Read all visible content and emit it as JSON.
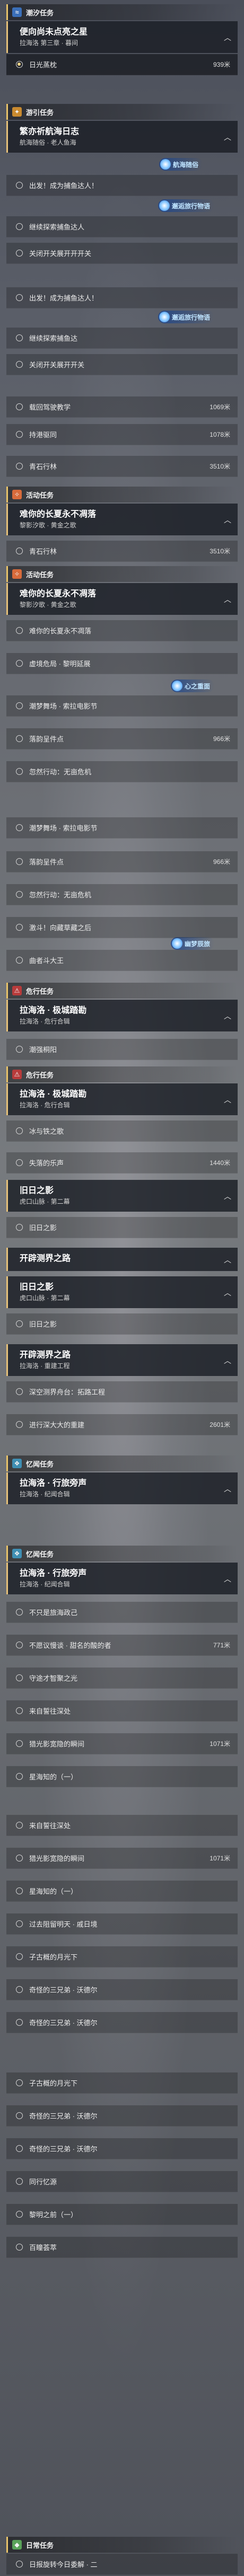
{
  "colors": {
    "accent": "#e8c36a",
    "panel": "#1a1d24",
    "badge": "#bfe4ff"
  },
  "categories": {
    "tide": {
      "label": "潮汐任务",
      "icon": "tide-icon"
    },
    "adventure": {
      "label": "游引任务",
      "icon": "compass-icon"
    },
    "event": {
      "label": "活动任务",
      "icon": "event-icon"
    },
    "danger": {
      "label": "危行任务",
      "icon": "danger-icon"
    },
    "danger_b": {
      "label": "危行任务"
    },
    "memory": {
      "label": "忆闻任务",
      "icon": "memory-icon"
    },
    "memory_b": {
      "label": "忆闻任务"
    },
    "daily": {
      "label": "日常任务",
      "icon": "daily-icon"
    }
  },
  "quests": {
    "q1": {
      "title": "便向尚未点亮之星",
      "sub": "拉海洛 第三章 · 暮间"
    },
    "q2": {
      "title": "繁亦祈航海日志",
      "sub": "航海随俗 · 老人鱼海"
    },
    "q3": {
      "title": "难你的长夏永不凋落",
      "sub": "黎影汐歌 · 黄金之歌"
    },
    "q4": {
      "title": "难你的长夏永不凋落",
      "sub": "黎影汐歌 · 黄金之歌"
    },
    "q5": {
      "title": "拉海洛 · 极城踏勘",
      "sub": "拉海洛 · 危行合辑"
    },
    "q6": {
      "title": "拉海洛 · 极城踏勘",
      "sub": "拉海洛 · 危行合辑"
    },
    "q7": {
      "title": "旧日之影",
      "sub": "虎口山脉 · 第二幕"
    },
    "q8": {
      "title": "开辟测界之路",
      "sub": ""
    },
    "q9": {
      "title": "旧日之影",
      "sub": "虎口山脉 · 第二幕"
    },
    "q10": {
      "title": "开辟测界之路",
      "sub": "拉海洛 · 重建工程"
    },
    "q11": {
      "title": "拉海洛 · 行旅旁声",
      "sub": "拉海洛 · 纪闻合辑"
    },
    "q12": {
      "title": "拉海洛 · 行旅旁声",
      "sub": "拉海洛 · 纪闻合辑"
    }
  },
  "steps": {
    "s1": {
      "label": "日光蒸枕",
      "dist": "939米"
    },
    "s2": {
      "label": "出发！成为捕鱼达人！",
      "dist": ""
    },
    "s3": {
      "label": "继续探索捕鱼达人",
      "dist": ""
    },
    "s4": {
      "label": "关闭开关展开开开关",
      "dist": ""
    },
    "s5": {
      "label": "出发！成为捕鱼达人！",
      "dist": ""
    },
    "s6": {
      "label": "继续探索捕鱼达",
      "dist": ""
    },
    "s7": {
      "label": "关闭开关展开开关",
      "dist": ""
    },
    "s8": {
      "label": "载回驾驶教学",
      "dist": "1069米"
    },
    "s9": {
      "label": "持港驱同",
      "dist": "1078米"
    },
    "s10": {
      "label": "青石行林",
      "dist": "3510米"
    },
    "s11": {
      "label": "青石行林",
      "dist": "3510米"
    },
    "s12": {
      "label": "难你的长夏永不凋落",
      "dist": ""
    },
    "s13": {
      "label": "虚境危局 · 黎明延展",
      "dist": ""
    },
    "s14": {
      "label": "潮梦舞场 · 索拉电影节",
      "dist": ""
    },
    "s15": {
      "label": "落韵呈件点",
      "dist": "966米"
    },
    "s16": {
      "label": "忽然行动：无亩危机",
      "dist": ""
    },
    "s17": {
      "label": "潮梦舞场 · 索拉电影节",
      "dist": ""
    },
    "s18": {
      "label": "落韵呈件点",
      "dist": "966米"
    },
    "s19": {
      "label": "忽然行动：无亩危机",
      "dist": ""
    },
    "s20": {
      "label": "激斗！向藏草藏之后",
      "dist": ""
    },
    "s21": {
      "label": "曲者斗大王",
      "dist": ""
    },
    "s22": {
      "label": "潮强桐阳",
      "dist": ""
    },
    "s23": {
      "label": "冰与铁之歌",
      "dist": ""
    },
    "s24": {
      "label": "失落的乐声",
      "dist": "1440米"
    },
    "s25": {
      "label": "旧日之影",
      "dist": ""
    },
    "s26": {
      "label": "旧日之影",
      "dist": ""
    },
    "s27": {
      "label": "深空测界舟台：拓路工程",
      "dist": ""
    },
    "s28": {
      "label": "进行深大大的重建",
      "dist": "2601米"
    },
    "s29": {
      "label": "不只是旅海政己",
      "dist": ""
    },
    "s30": {
      "label": "不愿议慢谈 · 甜名的酸的者",
      "dist": "771米"
    },
    "s31": {
      "label": "守途才智聚之光",
      "dist": ""
    },
    "s32": {
      "label": "来自誓往深处",
      "dist": ""
    },
    "s33": {
      "label": "猎光影宽隐的瞬间",
      "dist": "1071米"
    },
    "s34": {
      "label": "星海知的（一）",
      "dist": ""
    },
    "s35": {
      "label": "来自誓往深处",
      "dist": ""
    },
    "s36": {
      "label": "猎光影宽隐的瞬间",
      "dist": "1071米"
    },
    "s37": {
      "label": "星海知的（一）",
      "dist": ""
    },
    "s38": {
      "label": "过去阻留明天 · 戚日境",
      "dist": ""
    },
    "s39": {
      "label": "子古概的月光下",
      "dist": ""
    },
    "s40": {
      "label": "奇怪的三兄弟 · 沃德尔",
      "dist": ""
    },
    "s41": {
      "label": "奇怪的三兄弟 · 沃德尔",
      "dist": ""
    },
    "s42": {
      "label": "子古概的月光下",
      "dist": ""
    },
    "s43": {
      "label": "奇怪的三兄弟 · 沃德尔",
      "dist": ""
    },
    "s44": {
      "label": "奇怪的三兄弟 · 沃德尔",
      "dist": ""
    },
    "s45": {
      "label": "同行忆源",
      "dist": ""
    },
    "s46": {
      "label": "黎明之前（一）",
      "dist": ""
    },
    "s47": {
      "label": "百瞳荟萃",
      "dist": ""
    },
    "s48": {
      "label": "日报旋转今日委解 · 二",
      "dist": ""
    }
  },
  "badges": {
    "b1": "航海随俗",
    "b2": "邂逅旅行物语",
    "b3": "邂逅旅行物语",
    "b4": "心之重面",
    "b5": "心之重面",
    "b6": "幽梦辰旅"
  }
}
